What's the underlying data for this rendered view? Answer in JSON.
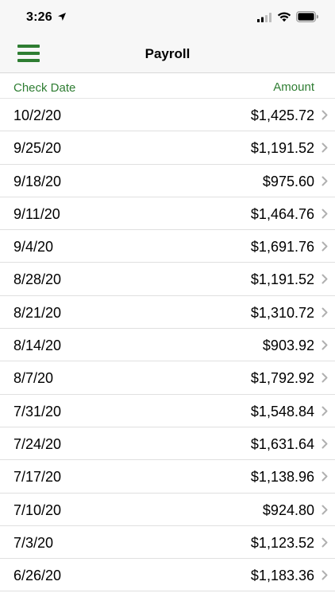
{
  "status_bar": {
    "time": "3:26"
  },
  "nav": {
    "title": "Payroll"
  },
  "list": {
    "columns": {
      "date": "Check Date",
      "amount": "Amount"
    },
    "rows": [
      {
        "date": "10/2/20",
        "amount": "$1,425.72"
      },
      {
        "date": "9/25/20",
        "amount": "$1,191.52"
      },
      {
        "date": "9/18/20",
        "amount": "$975.60"
      },
      {
        "date": "9/11/20",
        "amount": "$1,464.76"
      },
      {
        "date": "9/4/20",
        "amount": "$1,691.76"
      },
      {
        "date": "8/28/20",
        "amount": "$1,191.52"
      },
      {
        "date": "8/21/20",
        "amount": "$1,310.72"
      },
      {
        "date": "8/14/20",
        "amount": "$903.92"
      },
      {
        "date": "8/7/20",
        "amount": "$1,792.92"
      },
      {
        "date": "7/31/20",
        "amount": "$1,548.84"
      },
      {
        "date": "7/24/20",
        "amount": "$1,631.64"
      },
      {
        "date": "7/17/20",
        "amount": "$1,138.96"
      },
      {
        "date": "7/10/20",
        "amount": "$924.80"
      },
      {
        "date": "7/3/20",
        "amount": "$1,123.52"
      },
      {
        "date": "6/26/20",
        "amount": "$1,183.36"
      }
    ]
  },
  "colors": {
    "accent": "#2e7d32",
    "chevron": "#b0b0b0"
  },
  "icons": [
    "location-arrow-icon",
    "signal-icon",
    "wifi-icon",
    "battery-icon",
    "menu-icon",
    "chevron-right-icon"
  ]
}
